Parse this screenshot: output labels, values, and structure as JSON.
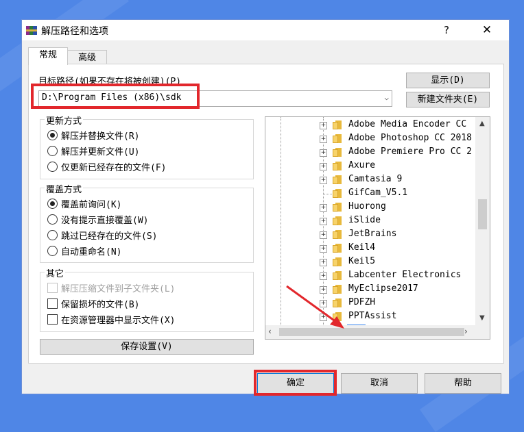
{
  "window": {
    "title": "解压路径和选项",
    "help_label": "?",
    "close_label": "✕"
  },
  "tabs": [
    {
      "label": "常规"
    },
    {
      "label": "高级"
    }
  ],
  "path": {
    "label": "目标路径(如果不存在将被创建)(P)",
    "value": "D:\\Program Files (x86)\\sdk",
    "dropdown_icon": "chevron-down-icon"
  },
  "buttons": {
    "show": "显示(D)",
    "new_folder": "新建文件夹(E)",
    "save_settings": "保存设置(V)",
    "ok": "确定",
    "cancel": "取消",
    "help": "帮助"
  },
  "update_mode": {
    "title": "更新方式",
    "options": [
      {
        "label": "解压并替换文件(R)",
        "selected": true
      },
      {
        "label": "解压并更新文件(U)",
        "selected": false
      },
      {
        "label": "仅更新已经存在的文件(F)",
        "selected": false
      }
    ]
  },
  "overwrite_mode": {
    "title": "覆盖方式",
    "options": [
      {
        "label": "覆盖前询问(K)",
        "selected": true
      },
      {
        "label": "没有提示直接覆盖(W)",
        "selected": false
      },
      {
        "label": "跳过已经存在的文件(S)",
        "selected": false
      },
      {
        "label": "自动重命名(N)",
        "selected": false
      }
    ]
  },
  "misc": {
    "title": "其它",
    "options": [
      {
        "label": "解压压缩文件到子文件夹(L)",
        "checked": false,
        "disabled": true
      },
      {
        "label": "保留损坏的文件(B)",
        "checked": false,
        "disabled": false
      },
      {
        "label": "在资源管理器中显示文件(X)",
        "checked": false,
        "disabled": false
      }
    ]
  },
  "folder_tree": {
    "items": [
      {
        "name": "Adobe Media Encoder CC",
        "expandable": true,
        "selected": false
      },
      {
        "name": "Adobe Photoshop CC 2018",
        "expandable": true,
        "selected": false
      },
      {
        "name": "Adobe Premiere Pro CC 2",
        "expandable": true,
        "selected": false
      },
      {
        "name": "Axure",
        "expandable": true,
        "selected": false
      },
      {
        "name": "Camtasia 9",
        "expandable": true,
        "selected": false
      },
      {
        "name": "GifCam_V5.1",
        "expandable": false,
        "selected": false
      },
      {
        "name": "Huorong",
        "expandable": true,
        "selected": false
      },
      {
        "name": "iSlide",
        "expandable": true,
        "selected": false
      },
      {
        "name": "JetBrains",
        "expandable": true,
        "selected": false
      },
      {
        "name": "Keil4",
        "expandable": true,
        "selected": false
      },
      {
        "name": "Keil5",
        "expandable": true,
        "selected": false
      },
      {
        "name": "Labcenter Electronics",
        "expandable": true,
        "selected": false
      },
      {
        "name": "MyEclipse2017",
        "expandable": true,
        "selected": false
      },
      {
        "name": "PDFZH",
        "expandable": true,
        "selected": false
      },
      {
        "name": "PPTAssist",
        "expandable": true,
        "selected": false
      },
      {
        "name": "sdk",
        "expandable": false,
        "selected": true
      }
    ]
  },
  "annotation": {
    "highlight_color": "#e2272c"
  },
  "colors": {
    "background": "#4f86e6",
    "selection": "#3a86f0",
    "accent_border": "#0078d7"
  }
}
